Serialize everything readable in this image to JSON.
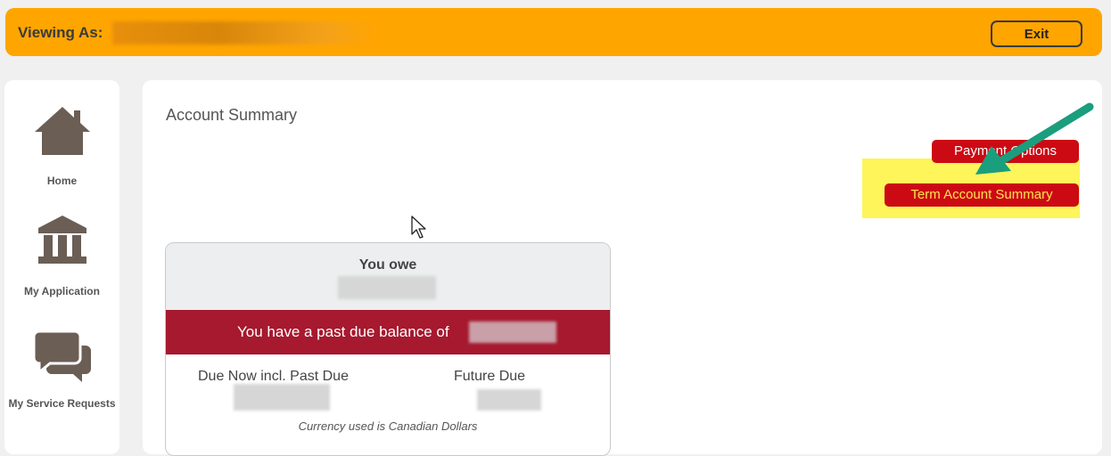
{
  "banner": {
    "label": "Viewing As:",
    "exit_label": "Exit"
  },
  "sidebar": {
    "items": [
      {
        "label": "Home",
        "icon": "house-icon"
      },
      {
        "label": "My Application",
        "icon": "bank-icon"
      },
      {
        "label": "My Service Requests",
        "icon": "chat-bubbles-icon"
      }
    ]
  },
  "main": {
    "title": "Account Summary",
    "payment_options_label": "Payment Options",
    "term_account_summary_label": "Term Account Summary",
    "card": {
      "you_owe_label": "You owe",
      "past_due_text": "You have a past due balance of",
      "due_now_label": "Due Now incl. Past Due",
      "future_due_label": "Future Due",
      "currency_note": "Currency used is Canadian Dollars"
    }
  },
  "colors": {
    "banner": "#ffa500",
    "button_red": "#cc0a14",
    "past_due_band": "#a6192e",
    "highlight": "#fdf55a",
    "arrow": "#1a9e7e",
    "icon_brown": "#6b5e55"
  }
}
